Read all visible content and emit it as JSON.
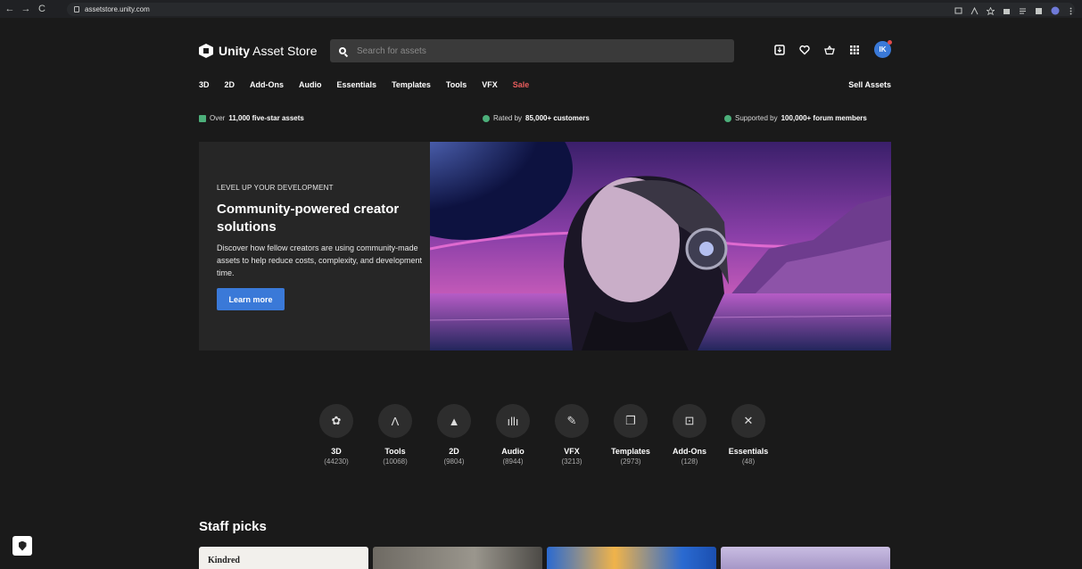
{
  "browser": {
    "url": "assetstore.unity.com",
    "back_glyph": "←",
    "forward_glyph": "→",
    "reload_glyph": "C"
  },
  "header": {
    "logo_bold": "Unity",
    "logo_rest": " Asset Store",
    "search_placeholder": "Search for assets",
    "avatar_initials": "IK",
    "icons": [
      "download-icon",
      "heart-icon",
      "basket-icon",
      "grid-icon"
    ]
  },
  "nav": {
    "items": [
      "3D",
      "2D",
      "Add-Ons",
      "Audio",
      "Essentials",
      "Templates",
      "Tools",
      "VFX"
    ],
    "sale": "Sale",
    "sell": "Sell Assets",
    "sale_color": "#e85c5c"
  },
  "trust": {
    "t1_pre": "Over ",
    "t1_bold": "11,000 five-star assets",
    "t2_pre": "Rated by ",
    "t2_bold": "85,000+ customers",
    "t3_pre": "Supported by ",
    "t3_bold": "100,000+ forum members"
  },
  "hero": {
    "eyebrow": "LEVEL UP YOUR DEVELOPMENT",
    "title": "Community-powered creator solutions",
    "body": "Discover how fellow creators are using community-made assets to help reduce costs, complexity, and development time.",
    "button": "Learn more",
    "accent": "#3a79d8"
  },
  "categories": [
    {
      "name": "3D",
      "count": "(44230)",
      "glyph": "✿",
      "icon": "cube-flower-icon"
    },
    {
      "name": "Tools",
      "count": "(10068)",
      "glyph": "Λ",
      "icon": "compass-icon"
    },
    {
      "name": "2D",
      "count": "(9804)",
      "glyph": "▲",
      "icon": "mountain-icon"
    },
    {
      "name": "Audio",
      "count": "(8944)",
      "glyph": "ıllı",
      "icon": "waveform-icon"
    },
    {
      "name": "VFX",
      "count": "(3213)",
      "glyph": "✎",
      "icon": "brush-icon"
    },
    {
      "name": "Templates",
      "count": "(2973)",
      "glyph": "❐",
      "icon": "template-icon"
    },
    {
      "name": "Add-Ons",
      "count": "(128)",
      "glyph": "⊡",
      "icon": "addon-folder-icon"
    },
    {
      "name": "Essentials",
      "count": "(48)",
      "glyph": "✕",
      "icon": "tools-cross-icon"
    }
  ],
  "staff_picks": {
    "title": "Staff picks",
    "card1_text": "Kindred"
  }
}
